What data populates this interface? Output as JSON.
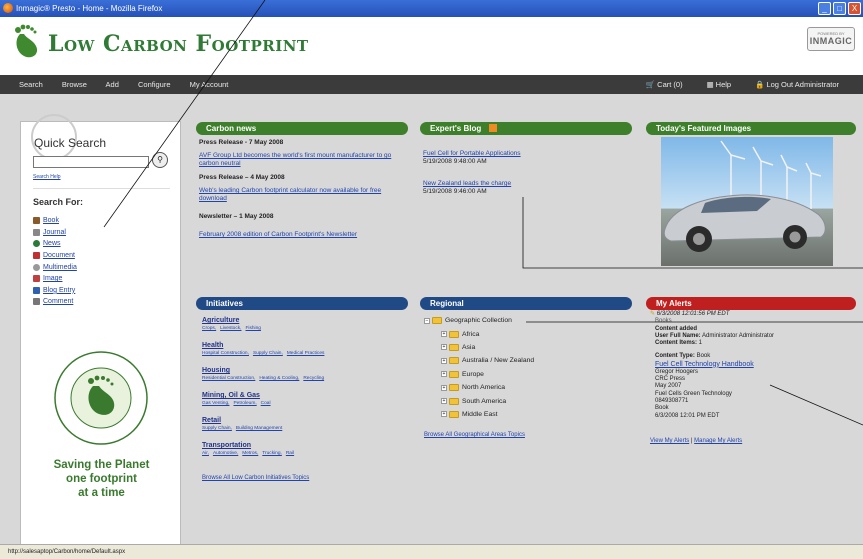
{
  "window": {
    "title": "Inmagic® Presto - Home - Mozilla Firefox",
    "controls": [
      "_",
      "□",
      "X"
    ]
  },
  "header": {
    "logo_text": "Low Carbon Footprint",
    "badge_small": "POWERED BY",
    "badge_brand": "INMAGIC"
  },
  "nav": {
    "left": [
      "Search",
      "Browse",
      "Add",
      "Configure",
      "My Account"
    ],
    "cart": "Cart (0)",
    "help": "Help",
    "logout": "Log Out Administrator"
  },
  "quick_search": {
    "title": "Quick Search",
    "search_help": "Search Help",
    "search_for_title": "Search For:",
    "items": [
      {
        "label": "Book",
        "icon": "book-icon",
        "color": "#8a5a2b"
      },
      {
        "label": "Journal",
        "icon": "journal-icon",
        "color": "#888888"
      },
      {
        "label": "News",
        "icon": "news-icon",
        "color": "#2a7a3a"
      },
      {
        "label": "Document",
        "icon": "document-icon",
        "color": "#c03030"
      },
      {
        "label": "Multimedia",
        "icon": "multimedia-icon",
        "color": "#999999"
      },
      {
        "label": "Image",
        "icon": "image-icon",
        "color": "#c04040"
      },
      {
        "label": "Blog Entry",
        "icon": "blog-icon",
        "color": "#3060b0"
      },
      {
        "label": "Comment",
        "icon": "comment-icon",
        "color": "#777777"
      }
    ],
    "slogan": [
      "Saving the Planet",
      "one footprint",
      "at a time"
    ]
  },
  "carbon_news": {
    "title": "Carbon news",
    "items": [
      {
        "heading": "Press Release - 7 May 2008",
        "link": "AVF Group Ltd becomes the world's first mount manufacturer to go carbon neutral"
      },
      {
        "heading": "Press Release – 4 May 2008",
        "link": "Web's leading Carbon footprint calculator now available for free download"
      },
      {
        "heading": "Newsletter – 1 May 2008",
        "link": "February 2008 edition of Carbon Footprint's Newsletter"
      }
    ]
  },
  "experts_blog": {
    "title": "Expert's Blog",
    "posts": [
      {
        "title": "Fuel Cell for Portable Applications",
        "date": "5/19/2008 9:48:00 AM"
      },
      {
        "title": "New Zealand leads the charge",
        "date": "5/19/2008 9:46:00 AM"
      }
    ]
  },
  "featured": {
    "title": "Today's Featured Images"
  },
  "initiatives": {
    "title": "Initiatives",
    "categories": [
      {
        "name": "Agriculture",
        "subs": [
          "Crops,",
          "Livestock,",
          "Fishing"
        ]
      },
      {
        "name": "Health",
        "subs": [
          "Hospital Construction,",
          "Supply Chain,",
          "Medical Practices"
        ]
      },
      {
        "name": "Housing",
        "subs": [
          "Residential Construction,",
          "Heating & Cooling,",
          "Recycling"
        ]
      },
      {
        "name": "Mining, Oil & Gas",
        "subs": [
          "Gas Venting,",
          "Petroleum,",
          "Coal"
        ]
      },
      {
        "name": "Retail",
        "subs": [
          "Supply Chain,",
          "Building Management"
        ]
      },
      {
        "name": "Transportation",
        "subs": [
          "Air,",
          "Automotive,",
          "Metros,",
          "Trucking,",
          "Rail"
        ]
      }
    ],
    "browse_all": "Browse All Low Carbon Initiatives Topics"
  },
  "regional": {
    "title": "Regional",
    "root": "Geographic Collection",
    "children": [
      "Africa",
      "Asia",
      "Australia / New Zealand",
      "Europe",
      "North America",
      "South America",
      "Middle East"
    ],
    "browse_all": "Browse All Geographical Areas Topics"
  },
  "alerts": {
    "title": "My Alerts",
    "timestamp": "6/3/2008 12:01:56 PM EDT",
    "lines_top": [
      "Books"
    ],
    "content_added": "Content added",
    "user_full_name_label": "User Full Name:",
    "user_full_name": "Administrator Administrator",
    "content_items_label": "Content Items:",
    "content_items": "1",
    "content_type_label": "Content Type:",
    "content_type": "Book",
    "book_link": "Fuel Cell Technology Handbook",
    "details": [
      "Gregor Hoogers",
      "CRC Press",
      "May 2007",
      "Fuel Cells Green Technology",
      "0849308771",
      "Book",
      "6/3/2008 12:01 PM EDT"
    ],
    "view_my_alerts": "View My Alerts",
    "separator": "|",
    "manage_my_alerts": "Manage My Alerts"
  },
  "status_bar": {
    "url": "http://salesaptop/Carbon/home/Default.aspx"
  }
}
